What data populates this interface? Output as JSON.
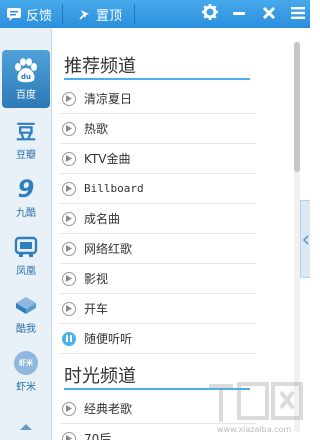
{
  "titlebar": {
    "feedback_label": "反馈",
    "pin_label": "置顶",
    "icons": [
      "feedback-icon",
      "pin-icon",
      "settings-icon",
      "minimize-icon",
      "close-icon",
      "menu-icon"
    ],
    "accent": "#2b8fdd"
  },
  "sidebar": {
    "items": [
      {
        "label": "百度",
        "glyph": "du",
        "icon": "baidu-icon",
        "active": true
      },
      {
        "label": "豆瓣",
        "glyph": "豆",
        "icon": "douban-icon"
      },
      {
        "label": "九酷",
        "glyph": "9",
        "icon": "jiuku-icon"
      },
      {
        "label": "凤凰",
        "glyph": "▣",
        "icon": "fenghuang-icon"
      },
      {
        "label": "酷我",
        "glyph": "◆",
        "icon": "kuwo-icon"
      },
      {
        "label": "虾米",
        "glyph": "虾米",
        "icon": "xiami-icon"
      }
    ]
  },
  "main": {
    "sections": [
      {
        "title": "推荐频道",
        "items": [
          {
            "label": "清凉夏日",
            "state": "play"
          },
          {
            "label": "热歌",
            "state": "play"
          },
          {
            "label": "KTV金曲",
            "state": "play"
          },
          {
            "label": "Billboard",
            "state": "play"
          },
          {
            "label": "成名曲",
            "state": "play"
          },
          {
            "label": "网络红歌",
            "state": "play"
          },
          {
            "label": "影视",
            "state": "play"
          },
          {
            "label": "开车",
            "state": "play"
          },
          {
            "label": "随便听听",
            "state": "playing"
          }
        ]
      },
      {
        "title": "时光频道",
        "items": [
          {
            "label": "经典老歌",
            "state": "play"
          },
          {
            "label": "70后",
            "state": "play"
          }
        ]
      }
    ]
  },
  "watermark": {
    "logo": "下载吧",
    "url": "www.xiazaiba.com"
  }
}
